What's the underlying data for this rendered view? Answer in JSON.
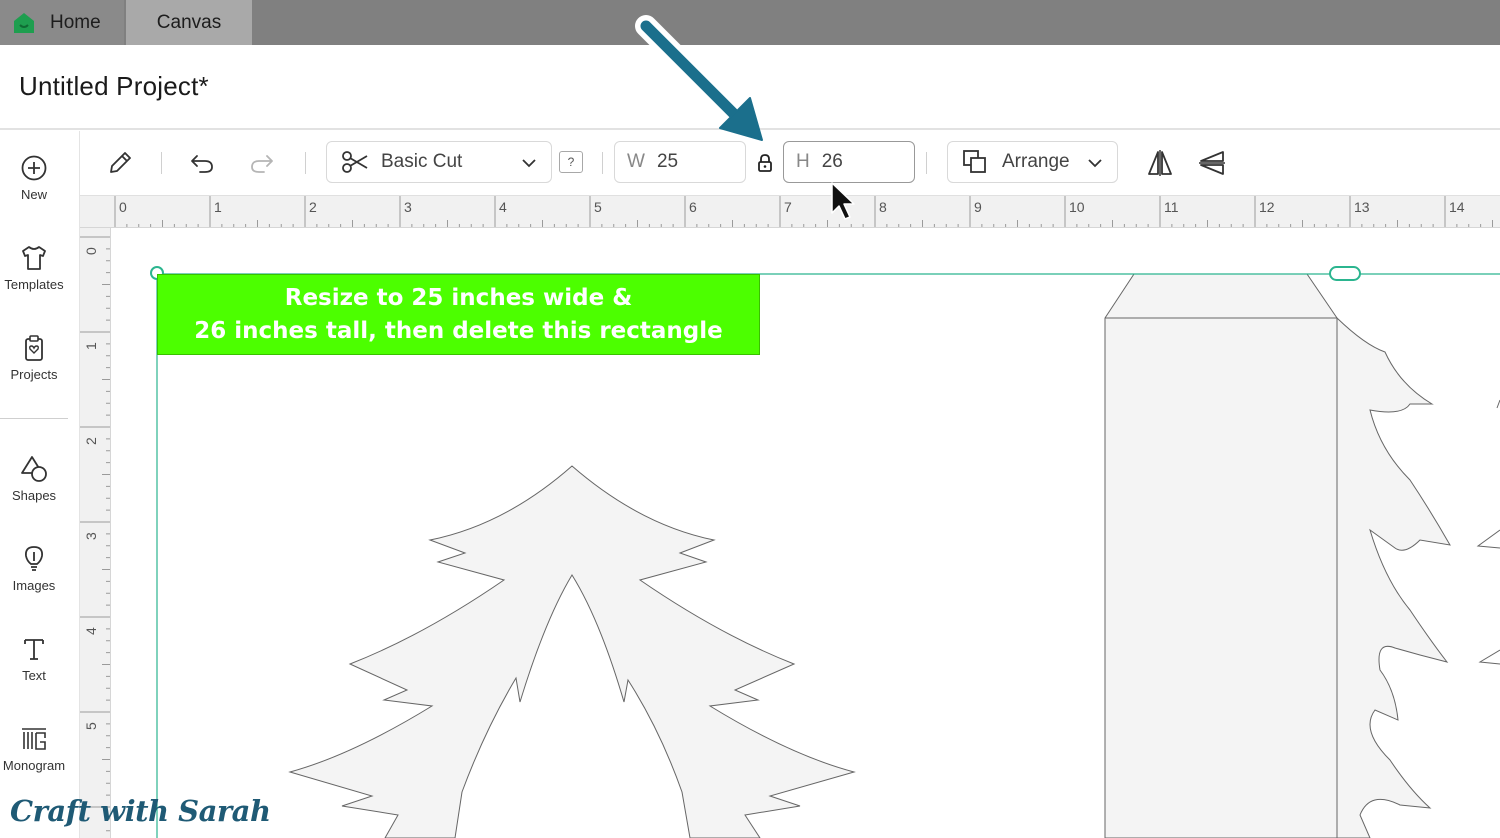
{
  "tabs": {
    "home_label": "Home",
    "canvas_label": "Canvas"
  },
  "project": {
    "title": "Untitled Project*"
  },
  "sidebar": {
    "items": [
      {
        "label": "New",
        "icon": "plus-circle-icon"
      },
      {
        "label": "Templates",
        "icon": "tshirt-icon"
      },
      {
        "label": "Projects",
        "icon": "clipboard-heart-icon"
      },
      {
        "label": "Shapes",
        "icon": "shapes-icon"
      },
      {
        "label": "Images",
        "icon": "lightbulb-icon"
      },
      {
        "label": "Text",
        "icon": "text-t-icon"
      },
      {
        "label": "Monogram",
        "icon": "monogram-icon"
      }
    ]
  },
  "toolbar": {
    "operation": {
      "value": "Basic Cut",
      "icon": "scissors-icon"
    },
    "help_label": "?",
    "width": {
      "label": "W",
      "value": "25"
    },
    "height": {
      "label": "H",
      "value": "26"
    },
    "lock_icon": "lock-icon",
    "arrange_label": "Arrange",
    "flip_horizontal_icon": "flip-horizontal-icon",
    "flip_vertical_icon": "flip-vertical-icon"
  },
  "ruler": {
    "top_labels": [
      "0",
      "1",
      "2",
      "3",
      "4",
      "5",
      "6",
      "7",
      "8",
      "9",
      "10",
      "11",
      "12",
      "13",
      "14"
    ],
    "left_labels": [
      "0",
      "1",
      "2",
      "3",
      "4",
      "5"
    ]
  },
  "canvas": {
    "note_lines": [
      "Resize to 25 inches wide &",
      "26 inches tall, then delete this rectangle"
    ],
    "selection_color": "#2bb58f",
    "note_color": "#4cff00"
  },
  "annotation": {
    "arrow_color": "#1b6f8c"
  },
  "watermark": "Craft with Sarah"
}
